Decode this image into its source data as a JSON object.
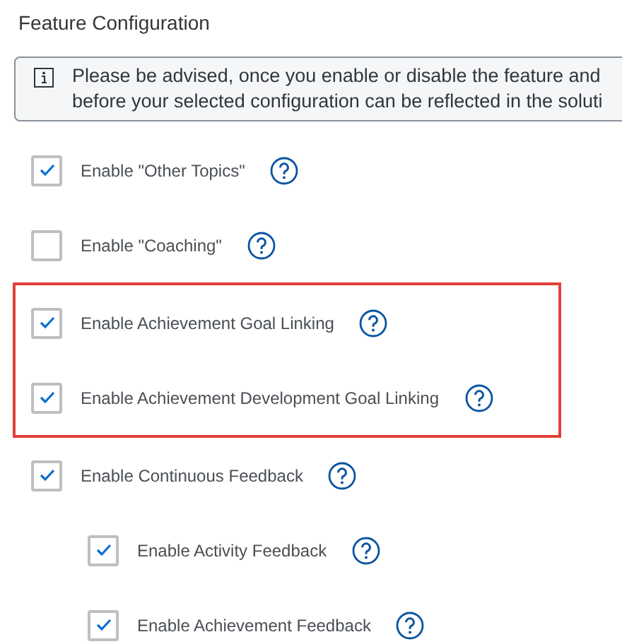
{
  "title": "Feature Configuration",
  "info": {
    "lines": [
      "Please be advised, once you enable or disable the feature and",
      "before your selected configuration can be reflected in the soluti"
    ]
  },
  "options": [
    {
      "kind": "option",
      "label": "Enable \"Other Topics\"",
      "checked": true
    },
    {
      "kind": "option",
      "label": "Enable \"Coaching\"",
      "checked": false
    },
    {
      "kind": "highlight_group",
      "items": [
        {
          "label": "Enable Achievement Goal Linking",
          "checked": true
        },
        {
          "label": "Enable Achievement Development Goal Linking",
          "checked": true
        }
      ]
    },
    {
      "kind": "option",
      "label": "Enable Continuous Feedback",
      "checked": true,
      "children": [
        {
          "label": "Enable Activity Feedback",
          "checked": true
        },
        {
          "label": "Enable Achievement Feedback",
          "checked": true
        }
      ]
    }
  ]
}
